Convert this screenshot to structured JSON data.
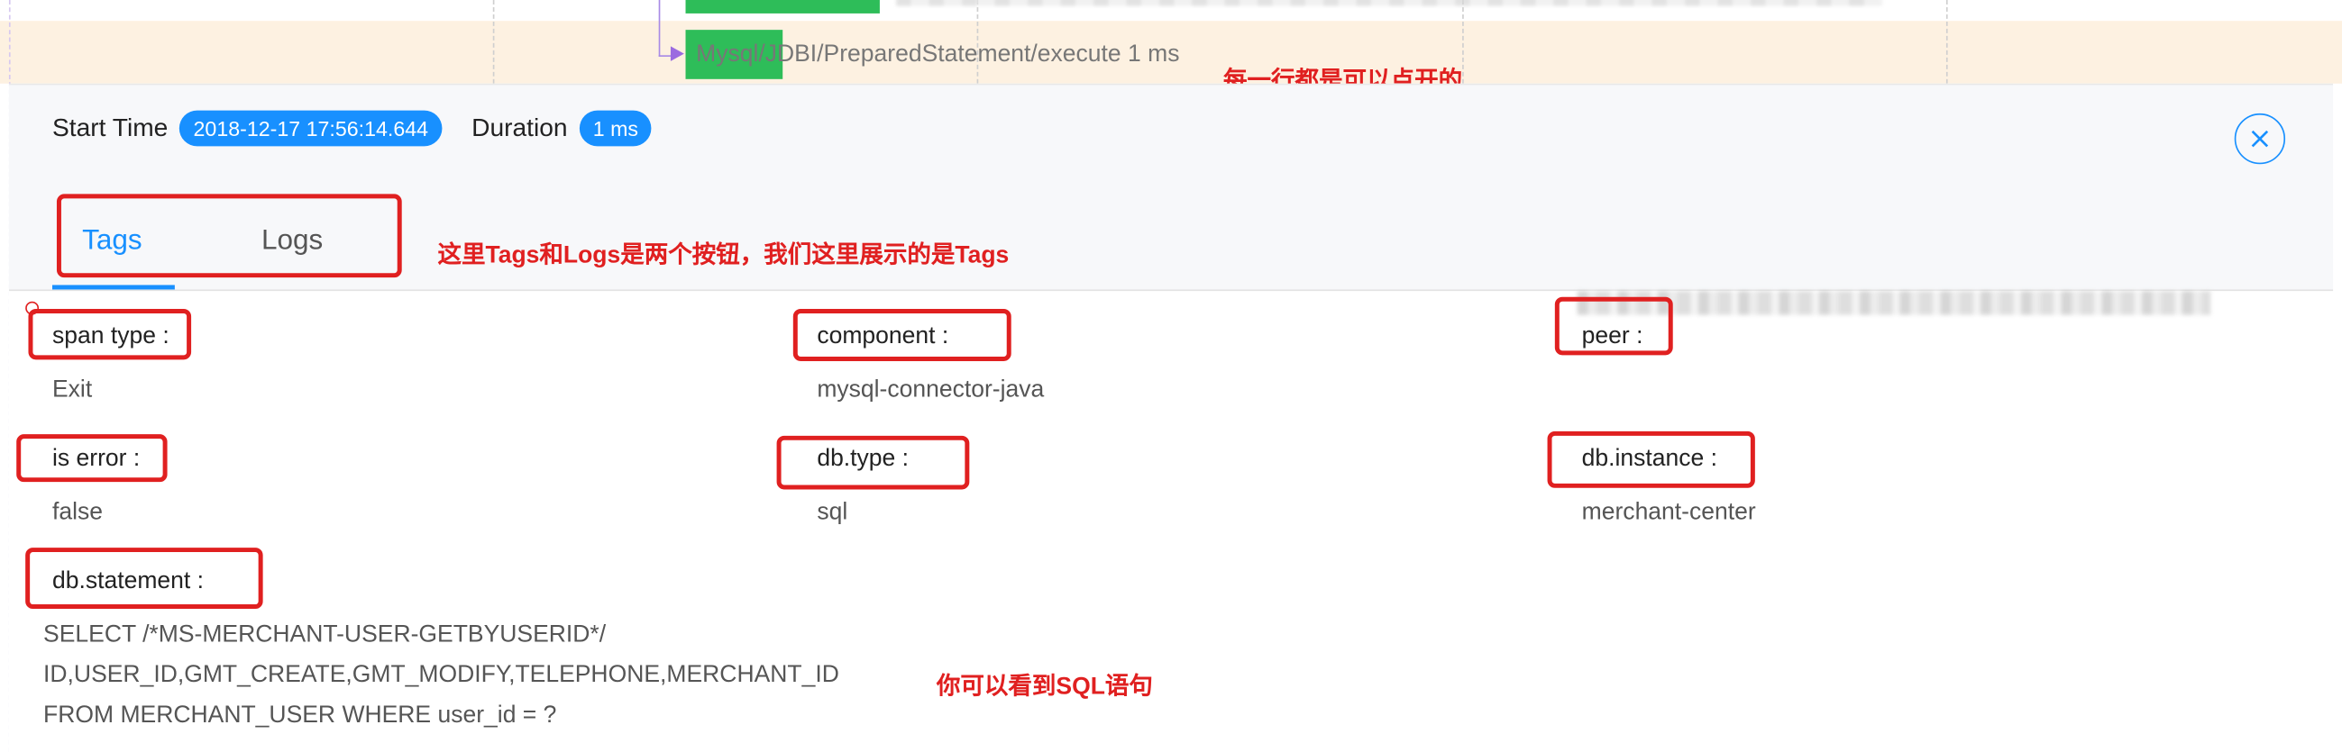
{
  "trace": {
    "span_label": "Mysql/JDBI/PreparedStatement/execute 1 ms"
  },
  "header": {
    "start_time_label": "Start Time",
    "start_time_value": "2018-12-17 17:56:14.644",
    "duration_label": "Duration",
    "duration_value": "1 ms",
    "close_icon": "close-circle-icon"
  },
  "tabs": [
    {
      "label": "Tags",
      "active": true
    },
    {
      "label": "Logs",
      "active": false
    }
  ],
  "tags": {
    "span_type": {
      "key": "span type :",
      "value": "Exit"
    },
    "component": {
      "key": "component :",
      "value": "mysql-connector-java"
    },
    "peer": {
      "key": "peer :",
      "value": ""
    },
    "is_error": {
      "key": "is error :",
      "value": "false"
    },
    "db_type": {
      "key": "db.type :",
      "value": "sql"
    },
    "db_instance": {
      "key": "db.instance :",
      "value": "merchant-center"
    },
    "db_statement": {
      "key": "db.statement :",
      "lines": [
        "SELECT /*MS-MERCHANT-USER-GETBYUSERID*/",
        "ID,USER_ID,GMT_CREATE,GMT_MODIFY,TELEPHONE,MERCHANT_ID",
        "FROM MERCHANT_USER WHERE user_id = ?"
      ]
    }
  },
  "annotations": {
    "rows_clickable": "每一行都是可以点开的",
    "tabs_note": "这里Tags和Logs是两个按钮，我们这里展示的是Tags",
    "sql_note": "你可以看到SQL语句"
  },
  "colors": {
    "accent": "#1890ff",
    "bar": "#2ebd59",
    "annotation": "#e02020",
    "highlight_row": "#fdf1e1"
  }
}
